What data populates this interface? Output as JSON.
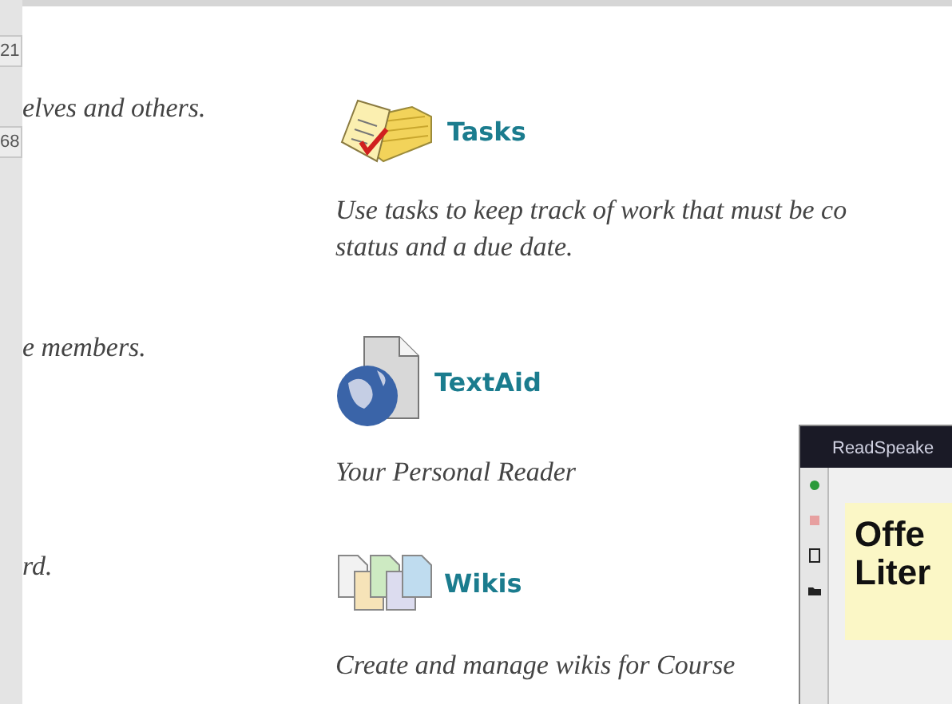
{
  "left_strip": {
    "cells": [
      "21",
      "68"
    ]
  },
  "rows": [
    {
      "left_text": "elves and others.",
      "tool": {
        "kind": "tasks",
        "name": "Tasks",
        "description_lines": [
          "Use tasks to keep track of work that must be co",
          "status and a due date."
        ]
      }
    },
    {
      "left_text": "e members.",
      "tool": {
        "kind": "textaid",
        "name": "TextAid",
        "description_lines": [
          "Your Personal Reader"
        ]
      }
    },
    {
      "left_text": "rd.",
      "tool": {
        "kind": "wikis",
        "name": "Wikis",
        "description_lines": [
          "Create and manage wikis for Course"
        ]
      }
    }
  ],
  "reader_window": {
    "title": "ReadSpeake",
    "heading_lines": [
      "Offe",
      "Liter"
    ]
  }
}
